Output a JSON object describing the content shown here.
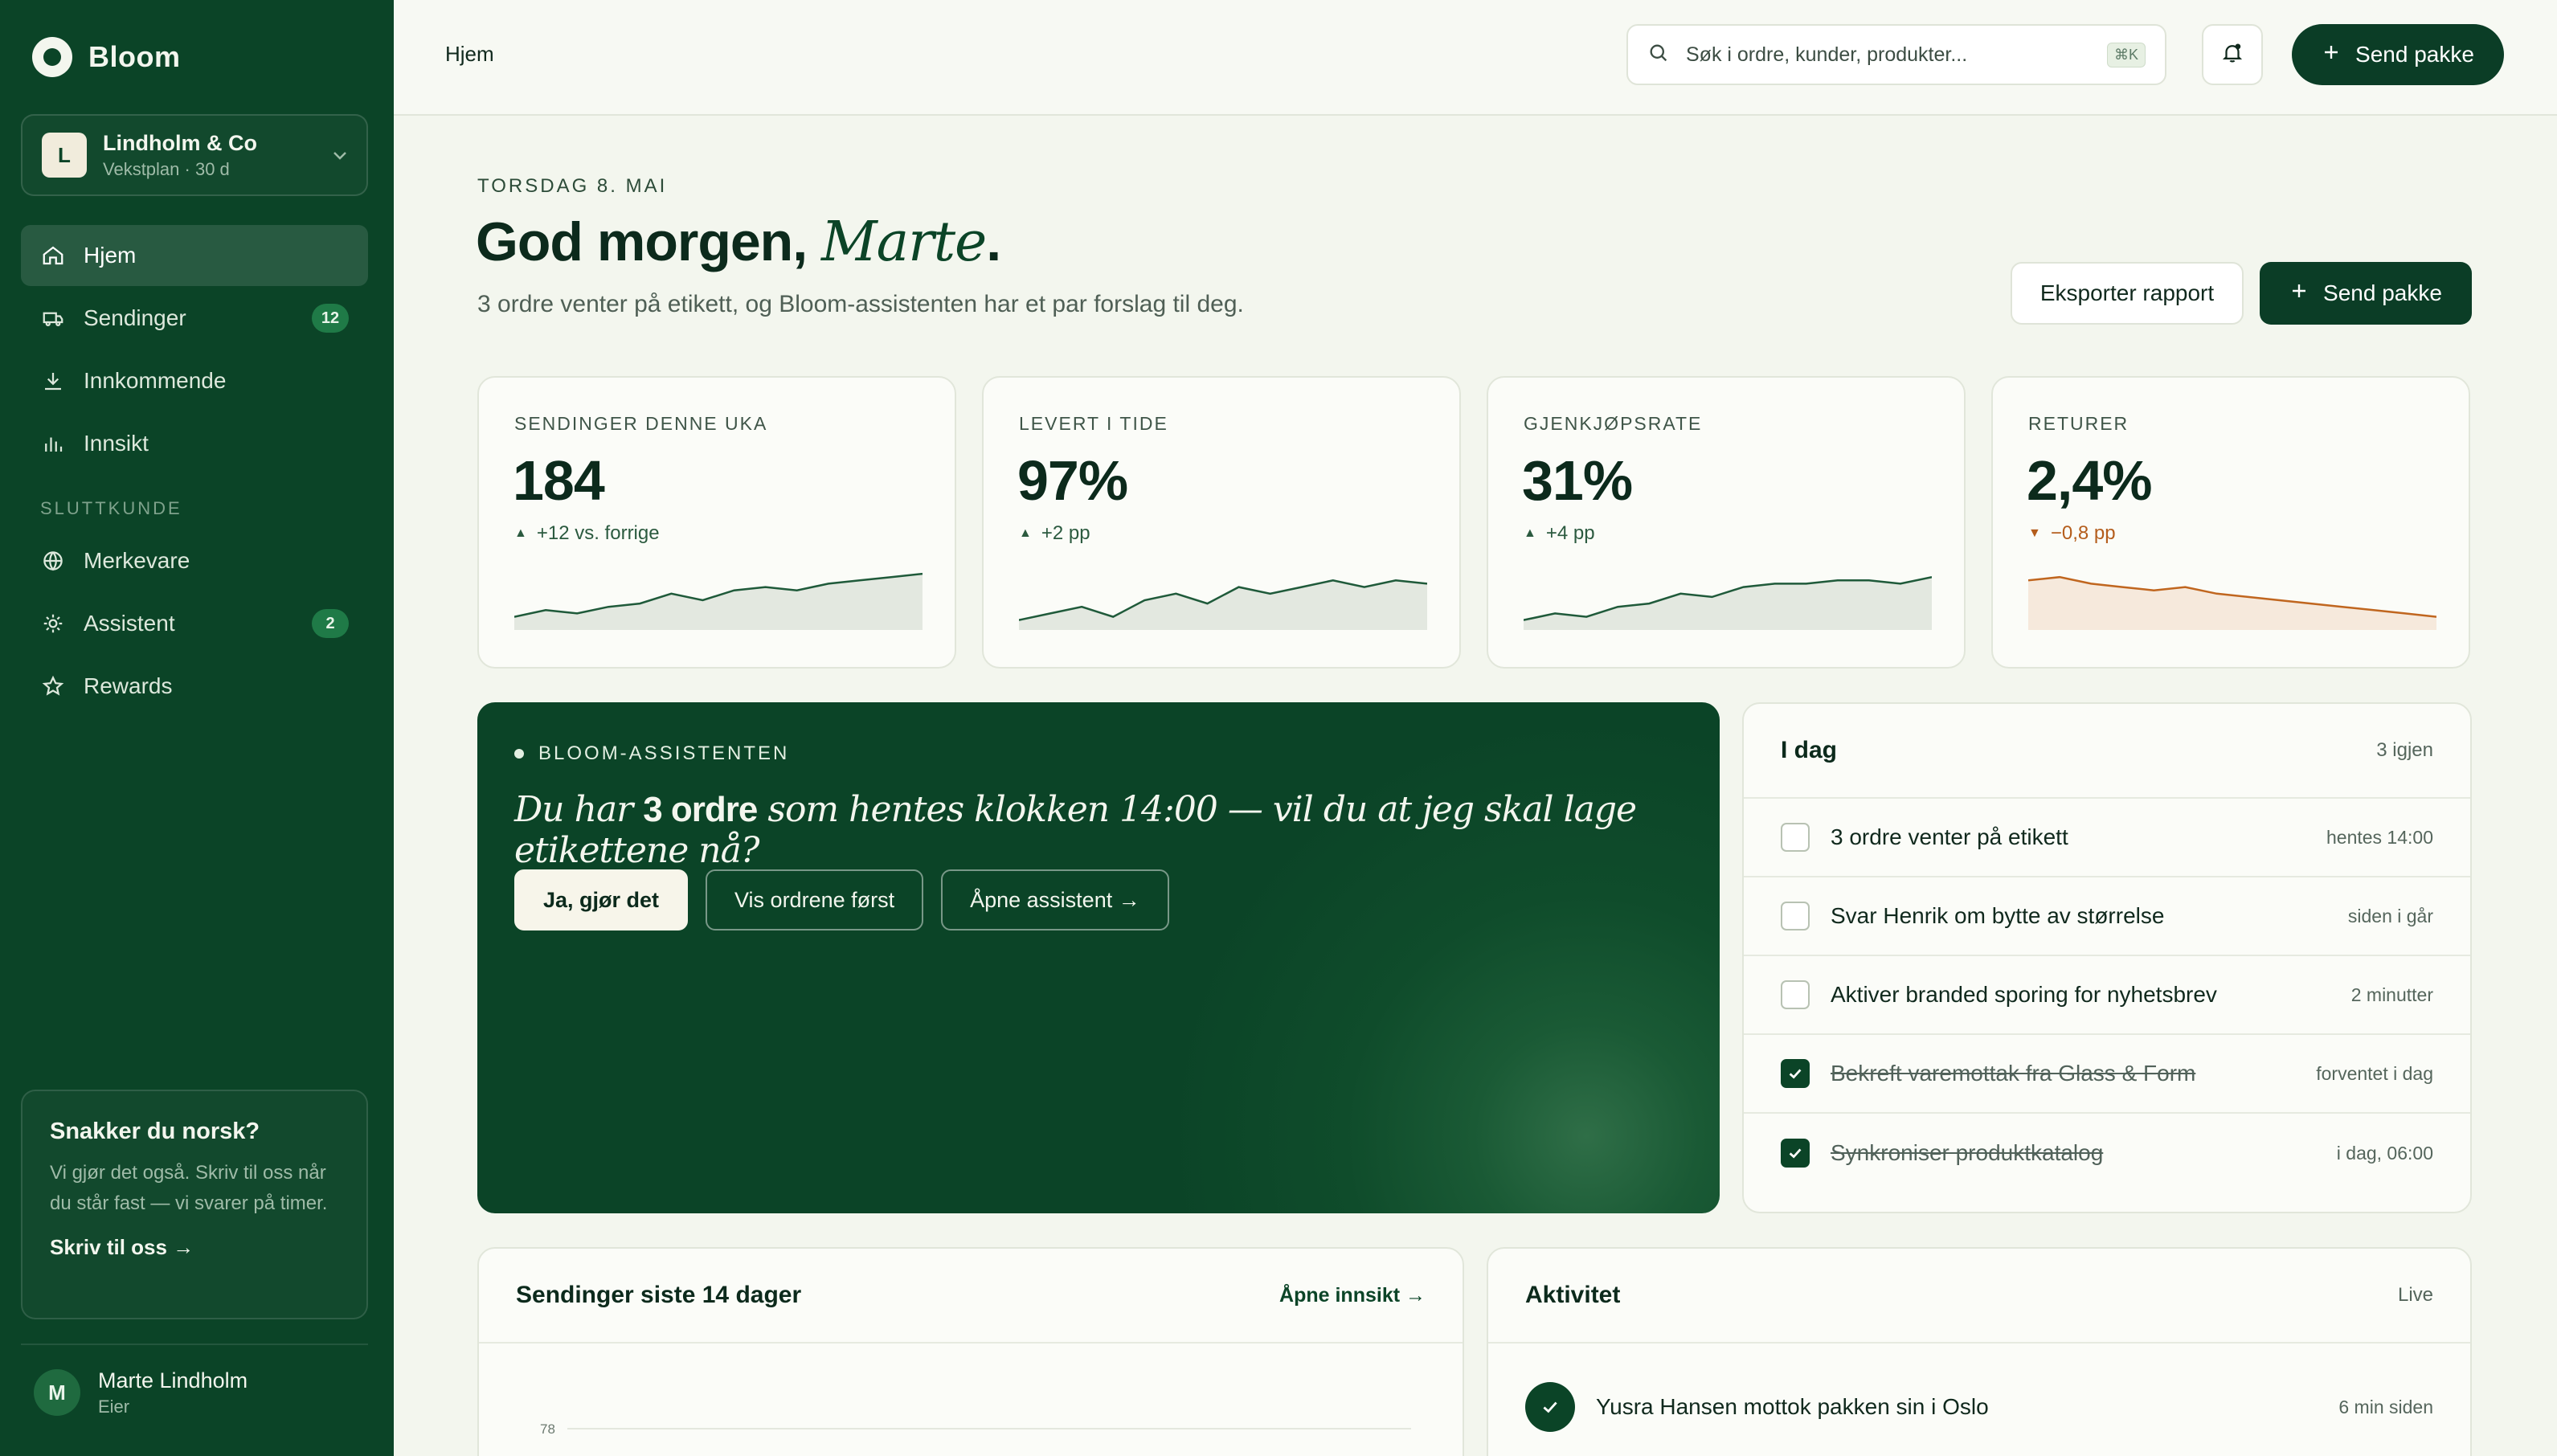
{
  "brand": {
    "name": "Bloom"
  },
  "org": {
    "initial": "L",
    "name": "Lindholm & Co",
    "plan": "Vekstplan · 30 d"
  },
  "nav": {
    "items": [
      {
        "label": "Hjem",
        "icon": "home-icon",
        "badge": ""
      },
      {
        "label": "Sendinger",
        "icon": "truck-icon",
        "badge": "12"
      },
      {
        "label": "Innkommende",
        "icon": "download-icon",
        "badge": ""
      },
      {
        "label": "Innsikt",
        "icon": "bar-chart-icon",
        "badge": ""
      }
    ],
    "section_label": "SLUTTKUNDE",
    "section_items": [
      {
        "label": "Merkevare",
        "icon": "globe-icon",
        "badge": ""
      },
      {
        "label": "Assistent",
        "icon": "sparkle-icon",
        "badge": "2"
      },
      {
        "label": "Rewards",
        "icon": "star-icon",
        "badge": ""
      }
    ]
  },
  "help": {
    "title": "Snakker du norsk?",
    "body": "Vi gjør det også. Skriv til oss når du står fast — vi svarer på timer.",
    "link": "Skriv til oss →"
  },
  "user": {
    "initial": "M",
    "name": "Marte Lindholm",
    "role": "Eier"
  },
  "topbar": {
    "breadcrumb": "Hjem",
    "search_placeholder": "Søk i ordre, kunder, produkter...",
    "shortcut": "⌘K",
    "send_label": "Send pakke"
  },
  "header": {
    "date": "TORSDAG 8. MAI",
    "greeting": "God morgen,",
    "name": "Marte",
    "period": ".",
    "subtitle": "3 ordre venter på etikett, og Bloom-assistenten har et par forslag til deg.",
    "export_label": "Eksporter rapport",
    "send_label": "Send pakke"
  },
  "stats": [
    {
      "label": "SENDINGER DENNE UKA",
      "value": "184",
      "arrow": "▲",
      "delta": "+12 vs. forrige",
      "trend": "up",
      "color": "#1f5a3a",
      "fill": "#e3e8e0",
      "points": [
        8,
        12,
        10,
        14,
        16,
        22,
        18,
        24,
        26,
        24,
        28,
        30,
        32,
        34
      ]
    },
    {
      "label": "LEVERT I TIDE",
      "value": "97%",
      "arrow": "▲",
      "delta": "+2 pp",
      "trend": "up",
      "color": "#1f5a3a",
      "fill": "#e3e8e0",
      "points": [
        6,
        10,
        14,
        8,
        18,
        22,
        16,
        26,
        22,
        26,
        30,
        26,
        30,
        28
      ]
    },
    {
      "label": "GJENKJØPSRATE",
      "value": "31%",
      "arrow": "▲",
      "delta": "+4 pp",
      "trend": "up",
      "color": "#1f5a3a",
      "fill": "#e3e8e0",
      "points": [
        6,
        10,
        8,
        14,
        16,
        22,
        20,
        26,
        28,
        28,
        30,
        30,
        28,
        32
      ]
    },
    {
      "label": "RETURER",
      "value": "2,4%",
      "arrow": "▼",
      "delta": "−0,8 pp",
      "trend": "down",
      "color": "#c0661f",
      "fill": "#f6e9dc",
      "points": [
        30,
        32,
        28,
        26,
        24,
        26,
        22,
        20,
        18,
        16,
        14,
        12,
        10,
        8
      ]
    }
  ],
  "assistant": {
    "tag": "BLOOM-ASSISTENTEN",
    "message_pre": "Du har ",
    "message_bold": "3 ordre",
    "message_post": " som hentes klokken 14:00 — vil du at jeg skal lage etikettene nå?",
    "actions": [
      "Ja, gjør det",
      "Vis ordrene først",
      "Åpne assistent →"
    ]
  },
  "today": {
    "title": "I dag",
    "count": "3 igjen",
    "tasks": [
      {
        "label": "3 ordre venter på etikett",
        "meta": "hentes 14:00",
        "done": false
      },
      {
        "label": "Svar Henrik om bytte av størrelse",
        "meta": "siden i går",
        "done": false
      },
      {
        "label": "Aktiver branded sporing for nyhetsbrev",
        "meta": "2 minutter",
        "done": false
      },
      {
        "label": "Bekreft varemottak fra Glass & Form",
        "meta": "forventet i dag",
        "done": true
      },
      {
        "label": "Synkroniser produktkatalog",
        "meta": "i dag, 06:00",
        "done": true
      }
    ]
  },
  "shipments": {
    "title": "Sendinger siste 14 dager",
    "link": "Åpne innsikt →",
    "tick": "78"
  },
  "activity": {
    "title": "Aktivitet",
    "live": "Live",
    "rows": [
      {
        "pre": "Yusra Hansen",
        "post": " mottok pakken sin i Oslo",
        "time": "6 min siden",
        "icon": "check-icon"
      }
    ]
  },
  "colors": {
    "sidebar": "#0b4427",
    "accent": "#1f7a47",
    "background": "#f3f6ee",
    "negative": "#c0661f"
  }
}
